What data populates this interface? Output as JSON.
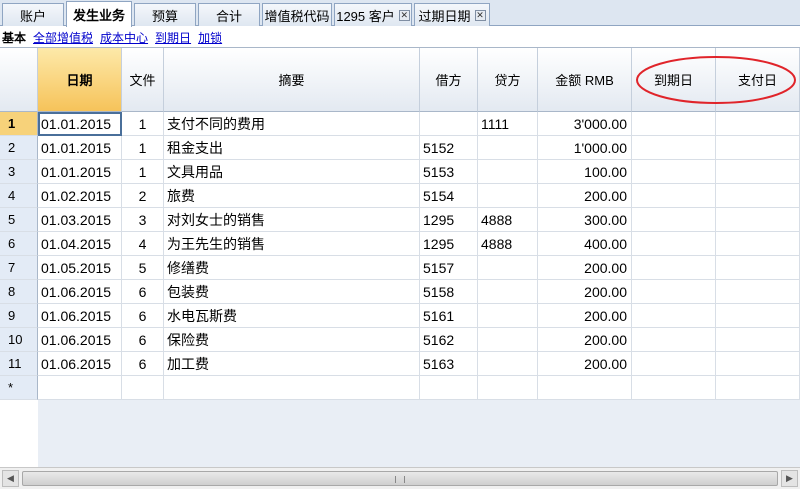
{
  "tabs": [
    {
      "label": "账户",
      "closable": false
    },
    {
      "label": "发生业务",
      "closable": false,
      "active": true
    },
    {
      "label": "预算",
      "closable": false
    },
    {
      "label": "合计",
      "closable": false
    },
    {
      "label": "增值税代码",
      "closable": false
    },
    {
      "label": "1295 客户",
      "closable": true
    },
    {
      "label": "过期日期",
      "closable": true
    }
  ],
  "views": {
    "current": "基本",
    "links": [
      "全部增值税",
      "成本中心",
      "到期日",
      "加锁"
    ]
  },
  "columns": {
    "date": "日期",
    "doc": "文件",
    "desc": "摘要",
    "debit": "借方",
    "credit": "贷方",
    "amount": "金额 RMB",
    "due": "到期日",
    "paid": "支付日"
  },
  "rows": [
    {
      "n": "1",
      "date": "01.01.2015",
      "doc": "1",
      "desc": "支付不同的费用",
      "debit": "",
      "credit": "1111",
      "amount": "3'000.00"
    },
    {
      "n": "2",
      "date": "01.01.2015",
      "doc": "1",
      "desc": "租金支出",
      "debit": "5152",
      "credit": "",
      "amount": "1'000.00"
    },
    {
      "n": "3",
      "date": "01.01.2015",
      "doc": "1",
      "desc": "文具用品",
      "debit": "5153",
      "credit": "",
      "amount": "100.00"
    },
    {
      "n": "4",
      "date": "01.02.2015",
      "doc": "2",
      "desc": "旅费",
      "debit": "5154",
      "credit": "",
      "amount": "200.00"
    },
    {
      "n": "5",
      "date": "01.03.2015",
      "doc": "3",
      "desc": "对刘女士的销售",
      "debit": "1295",
      "credit": "4888",
      "amount": "300.00"
    },
    {
      "n": "6",
      "date": "01.04.2015",
      "doc": "4",
      "desc": "为王先生的销售",
      "debit": "1295",
      "credit": "4888",
      "amount": "400.00"
    },
    {
      "n": "7",
      "date": "01.05.2015",
      "doc": "5",
      "desc": "修缮费",
      "debit": "5157",
      "credit": "",
      "amount": "200.00"
    },
    {
      "n": "8",
      "date": "01.06.2015",
      "doc": "6",
      "desc": "包装费",
      "debit": "5158",
      "credit": "",
      "amount": "200.00"
    },
    {
      "n": "9",
      "date": "01.06.2015",
      "doc": "6",
      "desc": "水电瓦斯费",
      "debit": "5161",
      "credit": "",
      "amount": "200.00"
    },
    {
      "n": "10",
      "date": "01.06.2015",
      "doc": "6",
      "desc": "保险费",
      "debit": "5162",
      "credit": "",
      "amount": "200.00"
    },
    {
      "n": "11",
      "date": "01.06.2015",
      "doc": "6",
      "desc": "加工费",
      "debit": "5163",
      "credit": "",
      "amount": "200.00"
    }
  ],
  "new_row_marker": "*",
  "colors": {
    "tabbar": "#dde6f1",
    "header_selected": "#f6c35a",
    "annotation_circle": "#e0242a",
    "link": "#0000cc"
  }
}
